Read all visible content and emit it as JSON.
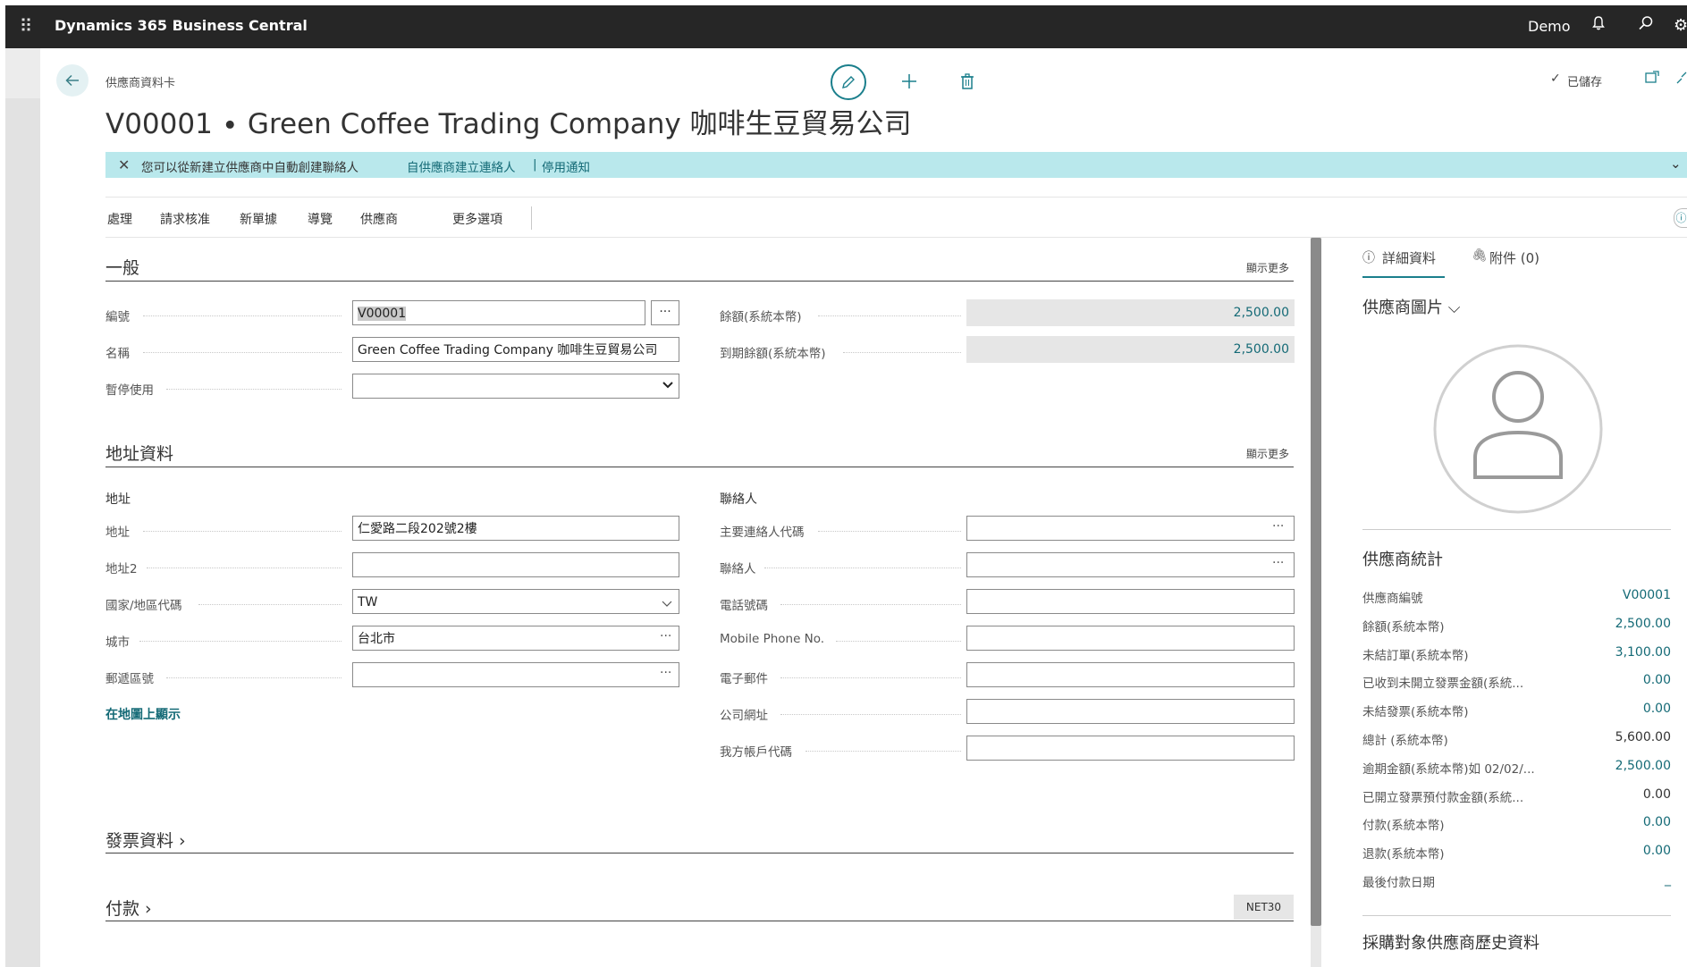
{
  "topbar": {
    "app_name": "Dynamics 365 Business Central",
    "company": "Demo"
  },
  "header": {
    "breadcrumb": "供應商資料卡",
    "title": "V00001 ∙ Green Coffee Trading Company 咖啡生豆貿易公司",
    "saved_status": "已儲存"
  },
  "notification": {
    "message": "您可以從新建立供應商中自動創建聯絡人",
    "link1": "自供應商建立連絡人",
    "separator": "|",
    "link2": "停用通知"
  },
  "actions": [
    "處理",
    "請求核准",
    "新單據",
    "導覽",
    "供應商",
    "更多選項"
  ],
  "general": {
    "title": "一般",
    "show_more": "顯示更多",
    "no_label": "編號",
    "no_value": "V00001",
    "name_label": "名稱",
    "name_value": "Green Coffee Trading Company 咖啡生豆貿易公司",
    "blocked_label": "暫停使用",
    "blocked_value": "",
    "balance_label": "餘額(系統本幣)",
    "balance_value": "2,500.00",
    "due_label": "到期餘額(系統本幣)",
    "due_value": "2,500.00"
  },
  "address": {
    "title": "地址資料",
    "show_more": "顯示更多",
    "address_header": "地址",
    "address_label": "地址",
    "address_value": "仁愛路二段202號2樓",
    "address2_label": "地址2",
    "address2_value": "",
    "country_label": "國家/地區代碼",
    "country_value": "TW",
    "city_label": "城市",
    "city_value": "台北市",
    "postcode_label": "郵遞區號",
    "postcode_value": "",
    "map_link": "在地圖上顯示",
    "contact_header": "聯絡人",
    "primary_contact_label": "主要連絡人代碼",
    "contact_label": "聯絡人",
    "phone_label": "電話號碼",
    "mobile_label": "Mobile Phone No.",
    "email_label": "電子郵件",
    "homepage_label": "公司網址",
    "our_account_label": "我方帳戶代碼"
  },
  "invoicing": {
    "title": "發票資料 ›"
  },
  "payments": {
    "title": "付款 ›",
    "badge": "NET30"
  },
  "factbox": {
    "tab_details": "詳細資料",
    "tab_attachments": "附件 (0)",
    "picture_title": "供應商圖片 ⌵",
    "stats_title": "供應商統計",
    "stats": [
      {
        "label": "供應商編號",
        "value": "V00001",
        "color": "#146a76"
      },
      {
        "label": "餘額(系統本幣)",
        "value": "2,500.00",
        "color": "#146a76"
      },
      {
        "label": "未結訂單(系統本幣)",
        "value": "3,100.00",
        "color": "#146a76"
      },
      {
        "label": "已收到未開立發票金額(系統...",
        "value": "0.00",
        "color": "#146a76"
      },
      {
        "label": "未結發票(系統本幣)",
        "value": "0.00",
        "color": "#146a76"
      },
      {
        "label": "總計 (系統本幣)",
        "value": "5,600.00",
        "color": "#333333"
      },
      {
        "label": "逾期金額(系統本幣)如 02/02/...",
        "value": "2,500.00",
        "color": "#146a76"
      },
      {
        "label": "已開立發票預付款金額(系統...",
        "value": "0.00",
        "color": "#333333"
      },
      {
        "label": "付款(系統本幣)",
        "value": "0.00",
        "color": "#146a76"
      },
      {
        "label": "退款(系統本幣)",
        "value": "0.00",
        "color": "#146a76"
      },
      {
        "label": "最後付款日期",
        "value": "_",
        "color": "#146a76"
      }
    ],
    "history_title": "採購對象供應商歷史資料"
  }
}
